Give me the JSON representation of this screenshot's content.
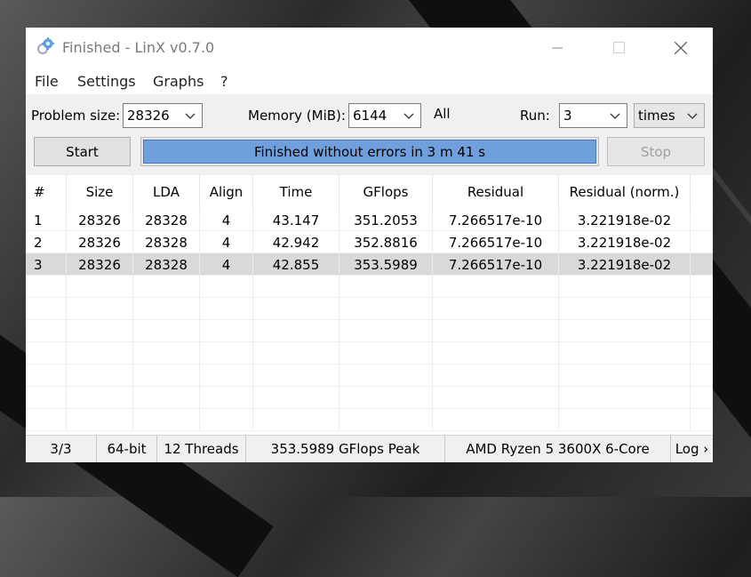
{
  "window": {
    "title": "Finished - LinX v0.7.0"
  },
  "menu": {
    "items": [
      "File",
      "Settings",
      "Graphs",
      "?"
    ]
  },
  "controls": {
    "problem_size_label": "Problem size:",
    "problem_size_value": "28326",
    "memory_label": "Memory (MiB):",
    "memory_value": "6144",
    "all_label": "All",
    "run_label": "Run:",
    "run_value": "3",
    "run_unit": "times",
    "start_label": "Start",
    "stop_label": "Stop"
  },
  "progress": {
    "text": "Finished without errors in 3 m 41 s",
    "fraction": 1.0
  },
  "table": {
    "columns": [
      "#",
      "Size",
      "LDA",
      "Align",
      "Time",
      "GFlops",
      "Residual",
      "Residual (norm.)"
    ],
    "rows": [
      [
        "1",
        "28326",
        "28328",
        "4",
        "43.147",
        "351.2053",
        "7.266517e-10",
        "3.221918e-02"
      ],
      [
        "2",
        "28326",
        "28328",
        "4",
        "42.942",
        "352.8816",
        "7.266517e-10",
        "3.221918e-02"
      ],
      [
        "3",
        "28326",
        "28328",
        "4",
        "42.855",
        "353.5989",
        "7.266517e-10",
        "3.221918e-02"
      ]
    ],
    "selected_row": 2
  },
  "status": {
    "progress_count": "3/3",
    "bitness": "64-bit",
    "threads": "12 Threads",
    "peak": "353.5989 GFlops Peak",
    "cpu": "AMD Ryzen 5 3600X 6-Core",
    "log": "Log ›"
  },
  "colors": {
    "progress_fill": "#6f9fdc",
    "selected_row": "#d9d9d9",
    "title_text": "#7a7a7a"
  },
  "icons": {
    "app": "gear-icon",
    "minimize": "minimize-icon",
    "maximize": "maximize-icon",
    "close": "close-icon",
    "dropdown": "chevron-down-icon"
  }
}
